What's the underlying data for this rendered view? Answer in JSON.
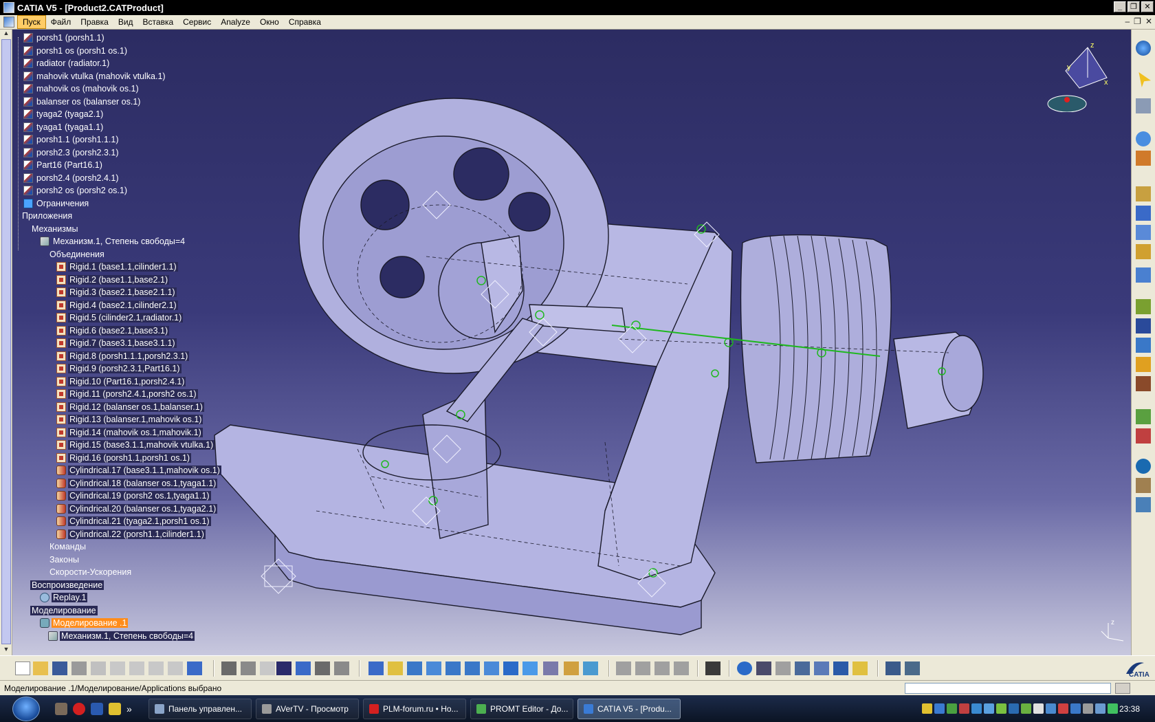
{
  "window": {
    "title": "CATIA V5 - [Product2.CATProduct]"
  },
  "menu": {
    "items": [
      "Пуск",
      "Файл",
      "Правка",
      "Вид",
      "Вставка",
      "Сервис",
      "Analyze",
      "Окно",
      "Справка"
    ],
    "active": "Пуск"
  },
  "tree": {
    "parts": [
      "porsh1 (porsh1.1)",
      "porsh1 os (porsh1 os.1)",
      "radiator (radiator.1)",
      "mahovik vtulka (mahovik vtulka.1)",
      "mahovik os (mahovik os.1)",
      "balanser os (balanser os.1)",
      "tyaga2 (tyaga2.1)",
      "tyaga1 (tyaga1.1)",
      "porsh1.1 (porsh1.1.1)",
      "porsh2.3 (porsh2.3.1)",
      "Part16 (Part16.1)",
      "porsh2.4 (porsh2.4.1)",
      "porsh2 os (porsh2 os.1)"
    ],
    "constraints": "Ограничения",
    "applications": "Приложения",
    "mechanisms": "Механизмы",
    "mechanism": "Механизм.1, Степень свободы=4",
    "joints_folder": "Объединения",
    "joints": [
      {
        "label": "Rigid.1 (base1.1,cilinder1.1)",
        "kind": "rigid"
      },
      {
        "label": "Rigid.2 (base1.1,base2.1)",
        "kind": "rigid"
      },
      {
        "label": "Rigid.3 (base2.1,base2.1.1)",
        "kind": "rigid"
      },
      {
        "label": "Rigid.4 (base2.1,cilinder2.1)",
        "kind": "rigid"
      },
      {
        "label": "Rigid.5 (cilinder2.1,radiator.1)",
        "kind": "rigid"
      },
      {
        "label": "Rigid.6 (base2.1,base3.1)",
        "kind": "rigid"
      },
      {
        "label": "Rigid.7 (base3.1,base3.1.1)",
        "kind": "rigid"
      },
      {
        "label": "Rigid.8 (porsh1.1.1,porsh2.3.1)",
        "kind": "rigid"
      },
      {
        "label": "Rigid.9 (porsh2.3.1,Part16.1)",
        "kind": "rigid"
      },
      {
        "label": "Rigid.10 (Part16.1,porsh2.4.1)",
        "kind": "rigid"
      },
      {
        "label": "Rigid.11 (porsh2.4.1,porsh2 os.1)",
        "kind": "rigid"
      },
      {
        "label": "Rigid.12 (balanser os.1,balanser.1)",
        "kind": "rigid"
      },
      {
        "label": "Rigid.13 (balanser.1,mahovik os.1)",
        "kind": "rigid"
      },
      {
        "label": "Rigid.14 (mahovik os.1,mahovik.1)",
        "kind": "rigid"
      },
      {
        "label": "Rigid.15 (base3.1.1,mahovik vtulka.1)",
        "kind": "rigid"
      },
      {
        "label": "Rigid.16 (porsh1.1,porsh1 os.1)",
        "kind": "rigid"
      },
      {
        "label": "Cylindrical.17 (base3.1.1,mahovik os.1)",
        "kind": "cyl"
      },
      {
        "label": "Cylindrical.18 (balanser os.1,tyaga1.1)",
        "kind": "cyl"
      },
      {
        "label": "Cylindrical.19 (porsh2 os.1,tyaga1.1)",
        "kind": "cyl"
      },
      {
        "label": "Cylindrical.20 (balanser os.1,tyaga2.1)",
        "kind": "cyl"
      },
      {
        "label": "Cylindrical.21 (tyaga2.1,porsh1 os.1)",
        "kind": "cyl"
      },
      {
        "label": "Cylindrical.22 (porsh1.1,cilinder1.1)",
        "kind": "cyl"
      }
    ],
    "commands": "Команды",
    "laws": "Законы",
    "speeds": "Скорости-Ускорения",
    "playback": "Воспроизведение",
    "replay": "Replay.1",
    "simulation": "Моделирование",
    "simulation_item": "Моделирование .1",
    "simulation_mechanism": "Механизм.1, Степень свободы=4"
  },
  "compass": {
    "z": "z",
    "x": "x",
    "y": "y"
  },
  "axis_corner": {
    "z": "z"
  },
  "status": {
    "text": "Моделирование .1/Моделирование/Applications выбрано"
  },
  "taskbar": {
    "tasks": [
      {
        "label": "Панель управлен...",
        "color": "#8aa4c8"
      },
      {
        "label": "AVerTV - Просмотр",
        "color": "#9a9a9a"
      },
      {
        "label": "PLM-forum.ru • Но...",
        "color": "#d42020"
      },
      {
        "label": "PROMT Editor - До...",
        "color": "#4caf50"
      },
      {
        "label": "CATIA V5 - [Produ...",
        "color": "#3a7bd5",
        "active": true
      }
    ],
    "clock": "23:38"
  },
  "brand": {
    "logo_text": "CATIA"
  },
  "colors": {
    "viewport_top": "#2c2c62",
    "viewport_bottom": "#c8c8de",
    "selection": "#ff8c1a",
    "model_face": "#b4b4e2"
  }
}
